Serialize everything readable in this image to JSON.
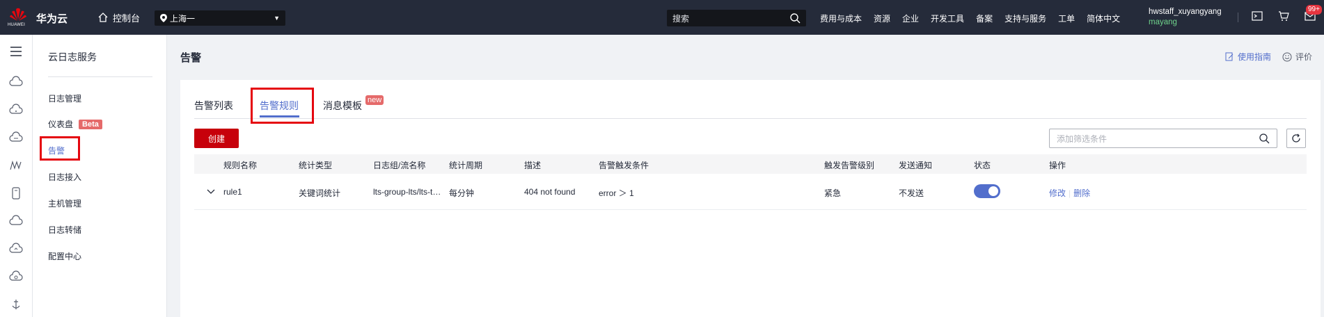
{
  "topbar": {
    "logo_text": "HUAWEI",
    "brand": "华为云",
    "console": "控制台",
    "region": "上海一",
    "search_placeholder": "搜索",
    "nav": [
      "费用与成本",
      "资源",
      "企业",
      "开发工具",
      "备案",
      "支持与服务",
      "工单",
      "简体中文"
    ],
    "user_name": "hwstaff_xuyangyang",
    "user_sub": "mayang",
    "badge": "99+"
  },
  "menu": {
    "title": "云日志服务",
    "items": [
      "日志管理",
      "仪表盘",
      "告警",
      "日志接入",
      "主机管理",
      "日志转储",
      "配置中心"
    ],
    "beta_label": "Beta"
  },
  "page": {
    "title": "告警",
    "guide": "使用指南",
    "rate": "评价"
  },
  "tabs": {
    "list": "告警列表",
    "rules": "告警规则",
    "template": "消息模板",
    "new_badge": "new"
  },
  "toolbar": {
    "create": "创建",
    "filter_placeholder": "添加筛选条件"
  },
  "table": {
    "headers": [
      "规则名称",
      "统计类型",
      "日志组/流名称",
      "统计周期",
      "描述",
      "告警触发条件",
      "触发告警级别",
      "发送通知",
      "状态",
      "操作"
    ],
    "rows": [
      {
        "name": "rule1",
        "stat_type": "关键词统计",
        "group": "lts-group-lts/lts-top...",
        "period": "每分钟",
        "desc": "404 not found",
        "condition": "error ＞ 1",
        "level": "紧急",
        "notify": "不发送",
        "status_on": true,
        "edit": "修改",
        "delete": "删除"
      }
    ]
  },
  "colors": {
    "accent": "#526ecc",
    "primary_button": "#c7000b",
    "highlight_box": "#e5070f",
    "topbar": "#252b3a"
  }
}
